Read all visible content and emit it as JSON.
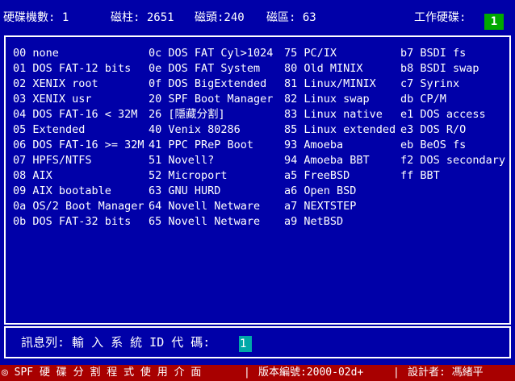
{
  "header": {
    "disks_label": "硬碟機數: 1",
    "cylinders_label": "磁柱: 2651",
    "heads_label": "磁頭:240",
    "sectors_label": "磁區: 63",
    "work_drive_label": "工作硬碟:",
    "work_drive_value": "1"
  },
  "partition_types": {
    "columns": [
      [
        "00 none",
        "01 DOS FAT-12 bits",
        "02 XENIX root",
        "03 XENIX usr",
        "04 DOS FAT-16 < 32M",
        "05 Extended",
        "06 DOS FAT-16 >= 32M",
        "07 HPFS/NTFS",
        "08 AIX",
        "09 AIX bootable",
        "0a OS/2 Boot Manager",
        "0b DOS FAT-32 bits"
      ],
      [
        "0c DOS FAT Cyl>1024",
        "0e DOS FAT System",
        "0f DOS BigExtended",
        "20 SPF Boot Manager",
        "26 [隱藏分割]",
        "40 Venix 80286",
        "41 PPC PReP Boot",
        "51 Novell?",
        "52 Microport",
        "63 GNU HURD",
        "64 Novell Netware",
        "65 Novell Netware"
      ],
      [
        "75 PC/IX",
        "80 Old MINIX",
        "81 Linux/MINIX",
        "82 Linux swap",
        "83 Linux native",
        "85 Linux extended",
        "93 Amoeba",
        "94 Amoeba BBT",
        "a5 FreeBSD",
        "a6 Open BSD",
        "a7 NEXTSTEP",
        "a9 NetBSD"
      ],
      [
        "b7 BSDI fs",
        "b8 BSDI swap",
        "c7 Syrinx",
        "db CP/M",
        "e1 DOS access",
        "e3 DOS R/O",
        "eb BeOS fs",
        "f2 DOS secondary",
        "ff BBT"
      ]
    ]
  },
  "message": {
    "label": "訊息列: 輸 入 系 統 ID 代 碼:",
    "input_value": "1"
  },
  "statusbar": {
    "app_title": "◎ SPF 硬 碟 分 割 程 式 使 用 介 面",
    "sep1": "|",
    "version": "版本編號:2000-02d+",
    "sep2": "|",
    "designer": "設計者: 馮緒平"
  },
  "colors": {
    "background": "#0000a8",
    "status_bar": "#a80000",
    "drive_box": "#00a800",
    "input_box": "#00a8a8"
  }
}
